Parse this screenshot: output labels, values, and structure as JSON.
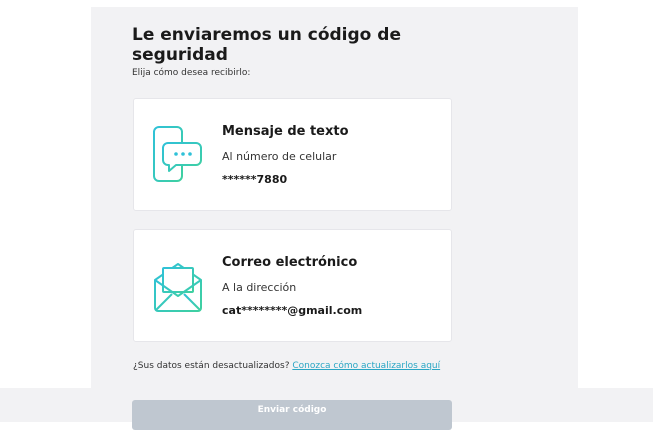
{
  "header": {
    "title": "Le enviaremos un código de seguridad",
    "subtitle": "Elija cómo desea recibirlo:"
  },
  "options": {
    "sms": {
      "icon": "phone-chat-icon",
      "title": "Mensaje de texto",
      "description": "Al número de celular",
      "value": "******7880"
    },
    "email": {
      "icon": "envelope-icon",
      "title": "Correo electrónico",
      "description": "A la dirección",
      "value": "cat********@gmail.com"
    }
  },
  "footer": {
    "outdated_text": "¿Sus datos están desactualizados?",
    "outdated_link": "Conozca cómo actualizarlos aquí"
  },
  "actions": {
    "send_label": "Enviar código"
  },
  "colors": {
    "accent": "#2aa6c4",
    "icon_gradient_start": "#2fc1d8",
    "icon_gradient_end": "#3fd0a0",
    "button_disabled": "#bfc7d0"
  }
}
